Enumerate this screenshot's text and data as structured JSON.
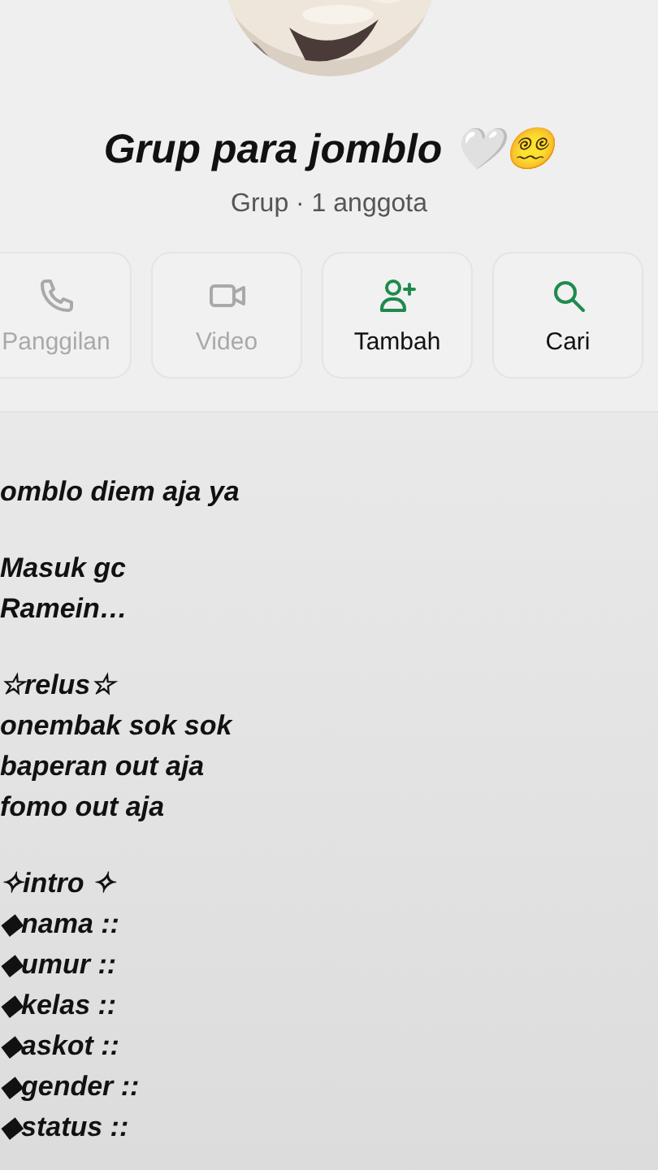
{
  "group": {
    "name": "Grup para jomblo 🤍😵‍💫",
    "subtitle": "Grup · 1 anggota"
  },
  "actions": [
    {
      "kind": "call",
      "label": "Panggilan",
      "disabled": true
    },
    {
      "kind": "video",
      "label": "Video",
      "disabled": true
    },
    {
      "kind": "add",
      "label": "Tambah",
      "disabled": false
    },
    {
      "kind": "search",
      "label": "Cari",
      "disabled": false
    }
  ],
  "description": [
    [
      "omblo diem aja ya"
    ],
    [
      "Masuk gc",
      "Ramein…"
    ],
    [
      "☆relus☆",
      "onembak sok sok",
      "baperan out aja",
      "fomo out aja"
    ],
    [
      "✧intro ✧",
      "◆nama ::",
      "◆umur ::",
      "◆kelas ::",
      "◆askot ::",
      "◆gender ::",
      "◆status ::"
    ]
  ]
}
